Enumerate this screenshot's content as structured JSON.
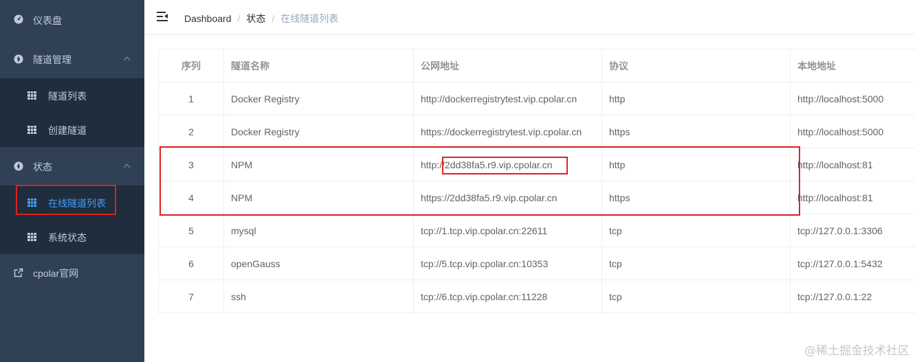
{
  "sidebar": {
    "dashboard": "仪表盘",
    "tunnel_manage": "隧道管理",
    "tunnel_list": "隧道列表",
    "create_tunnel": "创建隧道",
    "status": "状态",
    "online_tunnels": "在线隧道列表",
    "system_status": "系统状态",
    "website": "cpolar官网"
  },
  "header": {
    "breadcrumb": [
      "Dashboard",
      "状态",
      "在线隧道列表"
    ]
  },
  "table": {
    "columns": [
      "序列",
      "隧道名称",
      "公网地址",
      "协议",
      "本地地址"
    ],
    "rows": [
      [
        "1",
        "Docker Registry",
        "http://dockerregistrytest.vip.cpolar.cn",
        "http",
        "http://localhost:5000"
      ],
      [
        "2",
        "Docker Registry",
        "https://dockerregistrytest.vip.cpolar.cn",
        "https",
        "http://localhost:5000"
      ],
      [
        "3",
        "NPM",
        "http://2dd38fa5.r9.vip.cpolar.cn",
        "http",
        "http://localhost:81"
      ],
      [
        "4",
        "NPM",
        "https://2dd38fa5.r9.vip.cpolar.cn",
        "https",
        "http://localhost:81"
      ],
      [
        "5",
        "mysql",
        "tcp://1.tcp.vip.cpolar.cn:22611",
        "tcp",
        "tcp://127.0.0.1:3306"
      ],
      [
        "6",
        "openGauss",
        "tcp://5.tcp.vip.cpolar.cn:10353",
        "tcp",
        "tcp://127.0.0.1:5432"
      ],
      [
        "7",
        "ssh",
        "tcp://6.tcp.vip.cpolar.cn:11228",
        "tcp",
        "tcp://127.0.0.1:22"
      ]
    ]
  },
  "watermark": "@稀土掘金技术社区",
  "colors": {
    "sidebar_bg": "#304156",
    "submenu_bg": "#1f2d3d",
    "active": "#409eff",
    "highlight_box": "#e02020"
  }
}
